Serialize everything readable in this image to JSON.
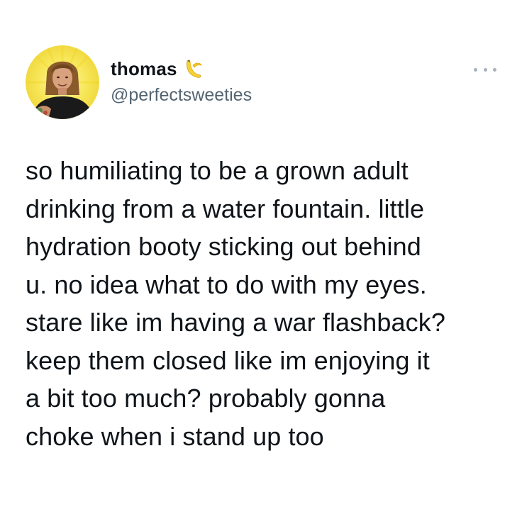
{
  "author": {
    "display_name": "thomas",
    "handle": "@perfectsweeties",
    "name_emoji": "banana-icon",
    "avatar": "profile-photo"
  },
  "menu": {
    "icon": "more-horizontal-icon"
  },
  "tweet": {
    "text": "so humiliating to be a grown adult\ndrinking from a water fountain. little\nhydration booty sticking out behind\nu. no idea what to do with my eyes.\nstare like im having a war flashback?\nkeep them closed like im enjoying it\na bit too much? probably gonna\nchoke when i stand up too"
  },
  "colors": {
    "text": "#0f1419",
    "handle": "#536471",
    "background": "#ffffff",
    "menu_dots": "#a7b1ba"
  }
}
